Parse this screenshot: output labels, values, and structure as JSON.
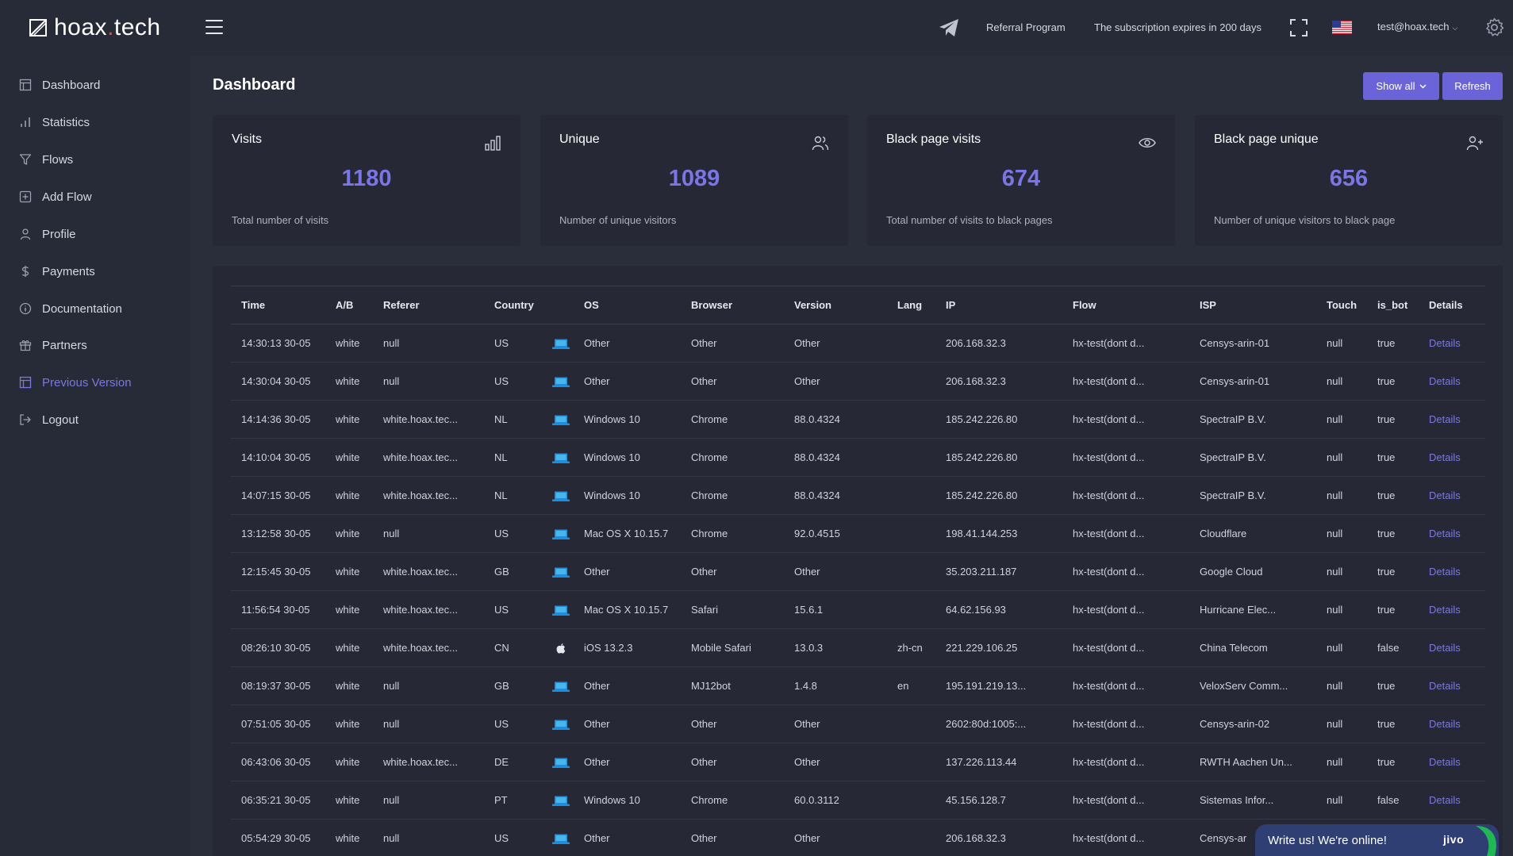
{
  "app": {
    "logo_text_main": "hoax",
    "logo_text_dot": ".",
    "logo_text_end": "tech"
  },
  "topbar": {
    "referral_label": "Referral Program",
    "subscription_text": "The subscription expires in 200 days",
    "user_email": "test@hoax.tech",
    "icons": [
      "telegram-icon",
      "fullscreen-icon",
      "us-flag-icon",
      "chevron-down-icon",
      "gear-icon"
    ]
  },
  "sidebar": {
    "items": [
      {
        "label": "Dashboard",
        "icon": "dashboard-icon"
      },
      {
        "label": "Statistics",
        "icon": "bar-chart-icon"
      },
      {
        "label": "Flows",
        "icon": "filter-icon"
      },
      {
        "label": "Add Flow",
        "icon": "plus-square-icon"
      },
      {
        "label": "Profile",
        "icon": "user-icon"
      },
      {
        "label": "Payments",
        "icon": "dollar-icon"
      },
      {
        "label": "Documentation",
        "icon": "info-icon"
      },
      {
        "label": "Partners",
        "icon": "gift-icon"
      },
      {
        "label": "Previous Version",
        "icon": "layout-icon"
      },
      {
        "label": "Logout",
        "icon": "logout-icon"
      }
    ],
    "highlight_color": "#7b78e0"
  },
  "main": {
    "title": "Dashboard",
    "show_all_label": "Show all",
    "refresh_label": "Refresh",
    "accent_color": "#6b63d8"
  },
  "cards": [
    {
      "title": "Visits",
      "value": "1180",
      "desc": "Total number of visits",
      "icon": "bar-chart-icon"
    },
    {
      "title": "Unique",
      "value": "1089",
      "desc": "Number of unique visitors",
      "icon": "users-icon"
    },
    {
      "title": "Black page visits",
      "value": "674",
      "desc": "Total number of visits to black pages",
      "icon": "eye-icon"
    },
    {
      "title": "Black page unique",
      "value": "656",
      "desc": "Number of unique visitors to black page",
      "icon": "user-plus-icon"
    }
  ],
  "table": {
    "headers": [
      "Time",
      "A/B",
      "Referer",
      "Country",
      "",
      "OS",
      "Browser",
      "Version",
      "Lang",
      "IP",
      "Flow",
      "ISP",
      "Touch",
      "is_bot",
      "Details"
    ],
    "rows": [
      [
        "14:30:13 30-05",
        "white",
        "null",
        "US",
        "laptop",
        "Other",
        "Other",
        "Other",
        "",
        "206.168.32.3",
        "hx-test(dont d...",
        "Censys-arin-01",
        "null",
        "true",
        "Details"
      ],
      [
        "14:30:04 30-05",
        "white",
        "null",
        "US",
        "laptop",
        "Other",
        "Other",
        "Other",
        "",
        "206.168.32.3",
        "hx-test(dont d...",
        "Censys-arin-01",
        "null",
        "true",
        "Details"
      ],
      [
        "14:14:36 30-05",
        "white",
        "white.hoax.tec...",
        "NL",
        "laptop",
        "Windows 10",
        "Chrome",
        "88.0.4324",
        "",
        "185.242.226.80",
        "hx-test(dont d...",
        "SpectraIP B.V.",
        "null",
        "true",
        "Details"
      ],
      [
        "14:10:04 30-05",
        "white",
        "white.hoax.tec...",
        "NL",
        "laptop",
        "Windows 10",
        "Chrome",
        "88.0.4324",
        "",
        "185.242.226.80",
        "hx-test(dont d...",
        "SpectraIP B.V.",
        "null",
        "true",
        "Details"
      ],
      [
        "14:07:15 30-05",
        "white",
        "white.hoax.tec...",
        "NL",
        "laptop",
        "Windows 10",
        "Chrome",
        "88.0.4324",
        "",
        "185.242.226.80",
        "hx-test(dont d...",
        "SpectraIP B.V.",
        "null",
        "true",
        "Details"
      ],
      [
        "13:12:58 30-05",
        "white",
        "null",
        "US",
        "laptop",
        "Mac OS X 10.15.7",
        "Chrome",
        "92.0.4515",
        "",
        "198.41.144.253",
        "hx-test(dont d...",
        "Cloudflare",
        "null",
        "true",
        "Details"
      ],
      [
        "12:15:45 30-05",
        "white",
        "white.hoax.tec...",
        "GB",
        "laptop",
        "Other",
        "Other",
        "Other",
        "",
        "35.203.211.187",
        "hx-test(dont d...",
        "Google Cloud",
        "null",
        "true",
        "Details"
      ],
      [
        "11:56:54 30-05",
        "white",
        "white.hoax.tec...",
        "US",
        "laptop",
        "Mac OS X 10.15.7",
        "Safari",
        "15.6.1",
        "",
        "64.62.156.93",
        "hx-test(dont d...",
        "Hurricane Elec...",
        "null",
        "true",
        "Details"
      ],
      [
        "08:26:10 30-05",
        "white",
        "white.hoax.tec...",
        "CN",
        "apple",
        "iOS 13.2.3",
        "Mobile Safari",
        "13.0.3",
        "zh-cn",
        "221.229.106.25",
        "hx-test(dont d...",
        "China Telecom",
        "null",
        "false",
        "Details"
      ],
      [
        "08:19:37 30-05",
        "white",
        "null",
        "GB",
        "laptop",
        "Other",
        "MJ12bot",
        "1.4.8",
        "en",
        "195.191.219.13...",
        "hx-test(dont d...",
        "VeloxServ Comm...",
        "null",
        "true",
        "Details"
      ],
      [
        "07:51:05 30-05",
        "white",
        "null",
        "US",
        "laptop",
        "Other",
        "Other",
        "Other",
        "",
        "2602:80d:1005:...",
        "hx-test(dont d...",
        "Censys-arin-02",
        "null",
        "true",
        "Details"
      ],
      [
        "06:43:06 30-05",
        "white",
        "white.hoax.tec...",
        "DE",
        "laptop",
        "Other",
        "Other",
        "Other",
        "",
        "137.226.113.44",
        "hx-test(dont d...",
        "RWTH Aachen Un...",
        "null",
        "true",
        "Details"
      ],
      [
        "06:35:21 30-05",
        "white",
        "null",
        "PT",
        "laptop",
        "Windows 10",
        "Chrome",
        "60.0.3112",
        "",
        "45.156.128.7",
        "hx-test(dont d...",
        "Sistemas Infor...",
        "null",
        "false",
        "Details"
      ],
      [
        "05:54:29 30-05",
        "white",
        "null",
        "US",
        "laptop",
        "Other",
        "Other",
        "Other",
        "",
        "206.168.32.3",
        "hx-test(dont d...",
        "Censys-ar",
        "null",
        "true",
        "Details"
      ]
    ]
  },
  "chat": {
    "text": "Write us! We're online!",
    "brand": "jivo"
  }
}
